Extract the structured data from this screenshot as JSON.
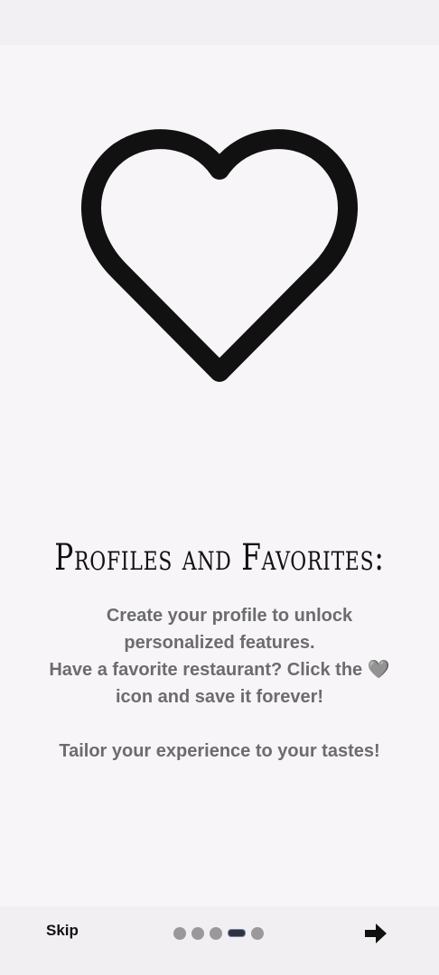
{
  "onboarding": {
    "title": "Profiles and Favorites:",
    "body_lines": [
      "Create your profile to unlock",
      "personalized features.",
      "Have a favorite restaurant? Click the 🩶",
      "icon and save it forever!",
      "",
      "Tailor your experience to your tastes!"
    ],
    "hero_icon": "heart-outline-icon"
  },
  "footer": {
    "skip_label": "Skip",
    "page_count": 5,
    "current_page": 4,
    "next_icon": "arrow-right-icon"
  },
  "colors": {
    "background": "#f7f5f8",
    "text_primary": "#111111",
    "text_body": "#6c6c6c",
    "dot_inactive": "#999999",
    "dot_active": "#2f3340"
  }
}
